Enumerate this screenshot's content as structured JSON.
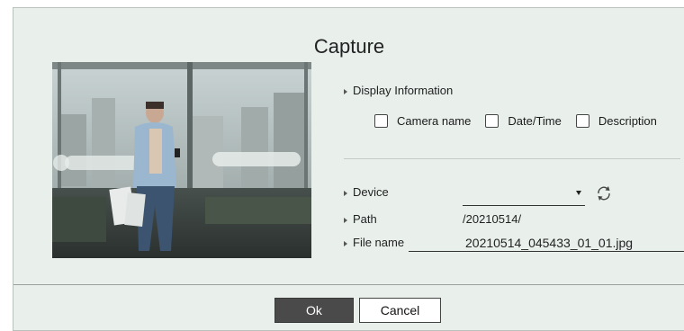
{
  "dialog": {
    "title": "Capture",
    "display_information": {
      "label": "Display Information",
      "options": [
        {
          "label": "Camera name",
          "checked": false
        },
        {
          "label": "Date/Time",
          "checked": false
        },
        {
          "label": "Description",
          "checked": false
        }
      ]
    },
    "device": {
      "label": "Device",
      "value": "",
      "refresh_icon": "refresh-icon"
    },
    "path": {
      "label": "Path",
      "value": "/20210514/"
    },
    "file_name": {
      "label": "File name",
      "value": "20210514_045433_01_01.jpg"
    },
    "buttons": {
      "ok": "Ok",
      "cancel": "Cancel"
    }
  },
  "colors": {
    "dialog_bg": "#e9f0ec",
    "ok_button_bg": "#4a4a4a"
  }
}
